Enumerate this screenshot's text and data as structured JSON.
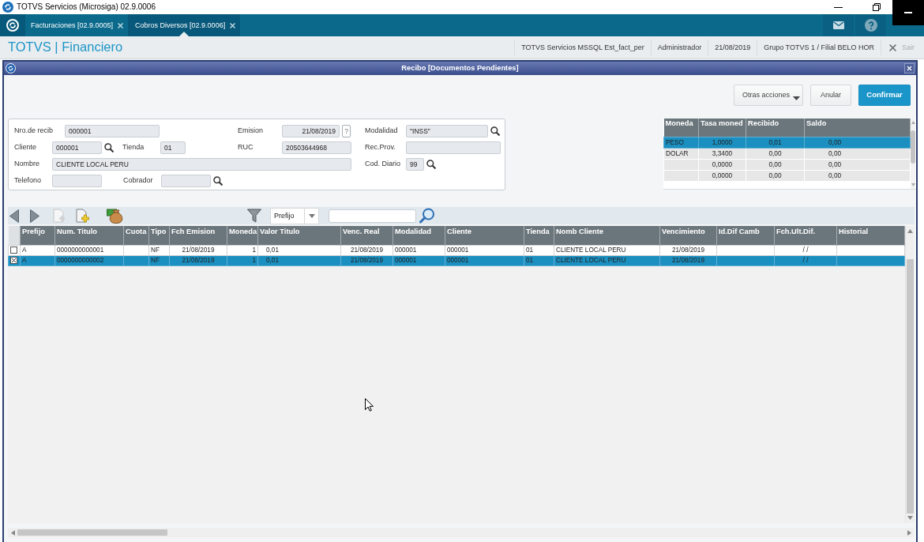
{
  "window": {
    "title": "TOTVS Servicios (Microsiga) 02.9.0006"
  },
  "tabs": [
    {
      "label": "Facturaciones [02.9.0005]",
      "selected": false
    },
    {
      "label": "Cobros Diversos [02.9.0006]",
      "selected": true
    }
  ],
  "header": {
    "title": "TOTVS | Financiero",
    "info": [
      "TOTVS Servicios MSSQL Est_fact_per",
      "Administrador",
      "21/08/2019",
      "Grupo TOTVS 1 / Filial BELO HOR"
    ],
    "logout": {
      "label": "Sair",
      "disabled": true
    }
  },
  "dialog": {
    "title": "Recibo [Documentos Pendientes]",
    "actions": [
      {
        "label": "Otras acciones",
        "kind": "menu"
      },
      {
        "label": "Anular",
        "kind": "secondary"
      },
      {
        "label": "Confirmar",
        "kind": "primary"
      }
    ],
    "form": {
      "fields": [
        {
          "label": "Nro.de recib",
          "value": "000001",
          "lookup": false
        },
        {
          "label": "Emision",
          "value": "21/08/2019",
          "lookup": false,
          "help": "?"
        },
        {
          "label": "Modalidad",
          "value": "\"INSS\"",
          "lookup": true
        },
        {
          "label": "Cliente",
          "value": "000001",
          "lookup": true
        },
        {
          "label": "Tienda",
          "value": "01",
          "lookup": false
        },
        {
          "label": "RUC",
          "value": "20503644968",
          "lookup": false
        },
        {
          "label": "Rec.Prov.",
          "lookup": false
        },
        {
          "label": "Nombre",
          "value": "CLIENTE LOCAL PERU",
          "lookup": false
        },
        {
          "label": "Cod. Diario",
          "value": "99",
          "lookup": true
        },
        {
          "label": "Telefono",
          "lookup": false
        },
        {
          "label": "Cobrador",
          "lookup": true
        }
      ]
    },
    "currency_table": {
      "columns": [
        "Moneda",
        "Tasa moned",
        "Recibido",
        "Saldo"
      ],
      "rows": [
        {
          "selected": true,
          "cells": [
            "PESO",
            "1,0000",
            "0,01",
            "0,00"
          ]
        },
        {
          "selected": false,
          "cells": [
            "DOLAR",
            "3,3400",
            "0,00",
            "0,00"
          ]
        },
        {
          "selected": false,
          "cells": [
            null,
            "0,0000",
            "0,00",
            "0,00"
          ]
        },
        {
          "selected": false,
          "cells": [
            null,
            "0,0000",
            "0,00",
            "0,00"
          ]
        }
      ]
    },
    "toolbar": {
      "filter_field": "Prefijo"
    },
    "grid": {
      "columns": [
        "Prefijo",
        "Num. Titulo",
        "Cuota",
        "Tipo",
        "Fch Emision",
        "Moneda",
        "Valor Titulo",
        "Venc. Real",
        "Modalidad",
        "Cliente",
        "Tienda",
        "Nomb Cliente",
        "Vencimiento",
        "Id.Dif Camb",
        "Fch.Ult.Dif.",
        "Historial"
      ],
      "rows": [
        {
          "checked": false,
          "selected": false,
          "cells": [
            "A",
            "0000000000001",
            null,
            "NF",
            "21/08/2019",
            "1",
            "0,01",
            "21/08/2019",
            "000001",
            "000001",
            "01",
            "CLIENTE LOCAL PERU",
            "21/08/2019",
            null,
            "/ /",
            null
          ]
        },
        {
          "checked": true,
          "selected": true,
          "cells": [
            "A",
            "0000000000002",
            null,
            "NF",
            "21/08/2019",
            "1",
            "0,01",
            "21/08/2019",
            "000001",
            "000001",
            "01",
            "CLIENTE LOCAL PERU",
            "21/08/2019",
            null,
            "/ /",
            null
          ]
        }
      ]
    }
  }
}
